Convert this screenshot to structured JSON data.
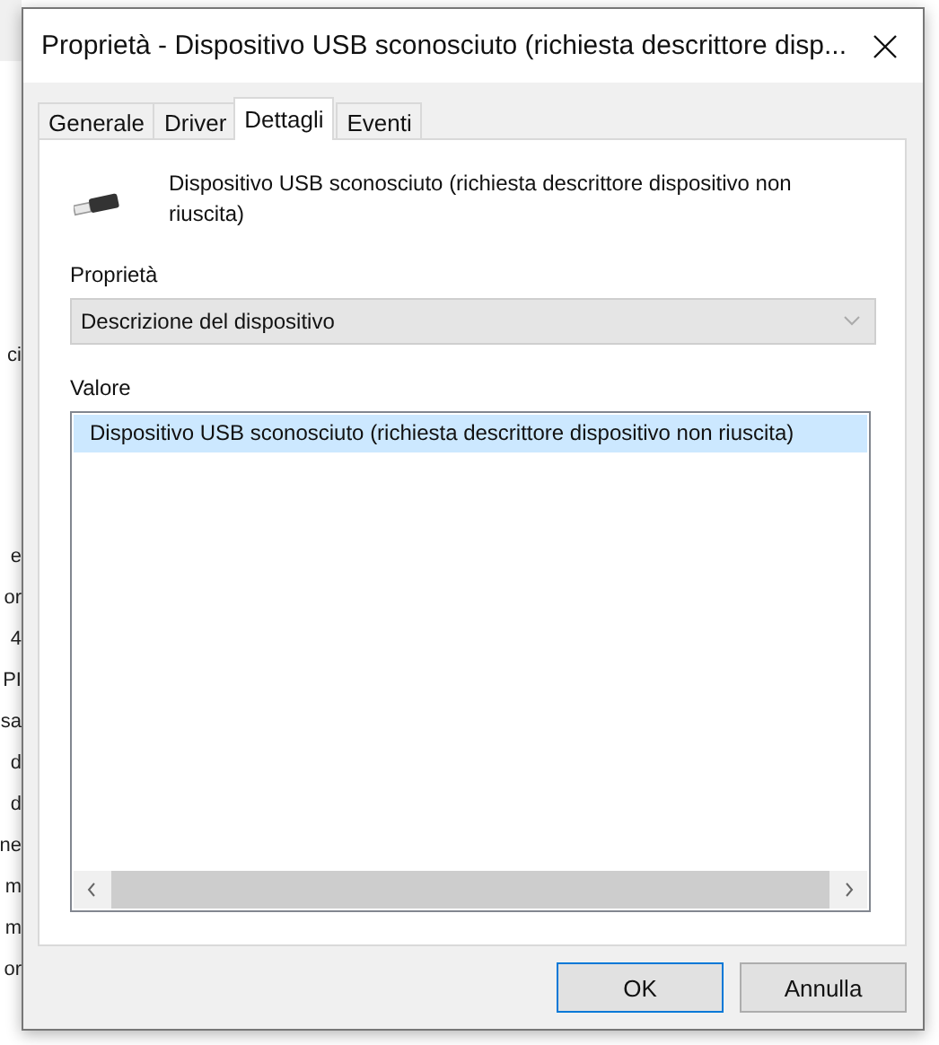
{
  "background_window": {
    "fragments": [
      "ci",
      "e",
      "or",
      "4",
      "PI",
      "sa",
      "d",
      "d",
      "ne",
      "m",
      "m",
      "or"
    ]
  },
  "window": {
    "title": "Proprietà - Dispositivo USB sconosciuto (richiesta descrittore disp..."
  },
  "tabs": [
    {
      "label": "Generale",
      "selected": false
    },
    {
      "label": "Driver",
      "selected": false
    },
    {
      "label": "Dettagli",
      "selected": true
    },
    {
      "label": "Eventi",
      "selected": false
    }
  ],
  "device": {
    "name": "Dispositivo USB sconosciuto (richiesta descrittore dispositivo non riuscita)"
  },
  "property": {
    "label": "Proprietà",
    "value": "Descrizione del dispositivo"
  },
  "value_list": {
    "label": "Valore",
    "items": [
      {
        "text": "Dispositivo USB sconosciuto (richiesta descrittore dispositivo non riuscita)",
        "selected": true
      }
    ]
  },
  "buttons": [
    {
      "label": "OK",
      "default": true
    },
    {
      "label": "Annulla",
      "default": false
    }
  ]
}
